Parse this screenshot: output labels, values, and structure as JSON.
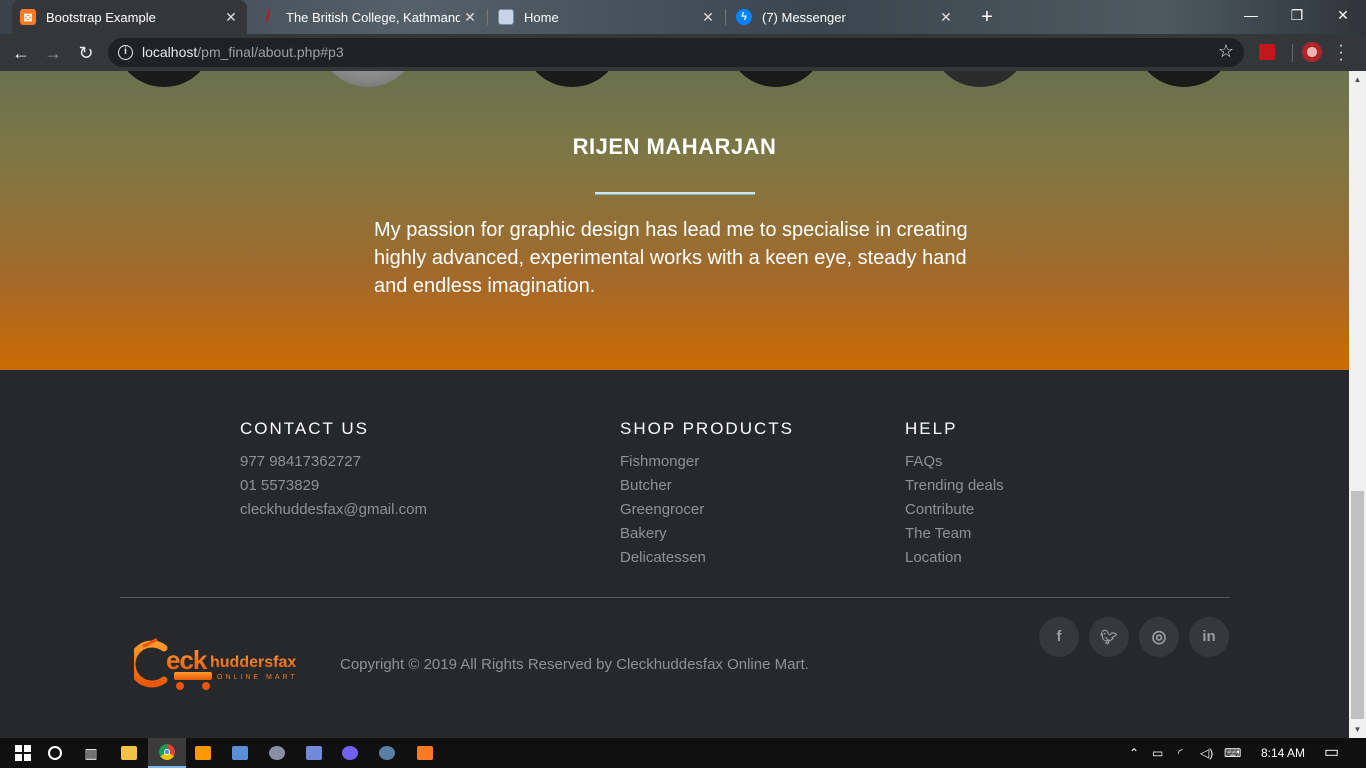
{
  "browser": {
    "tabs": [
      {
        "title": "Bootstrap Example",
        "icon": "xampp-icon",
        "color": "#fb7a24",
        "active": true
      },
      {
        "title": "The British College, Kathmandu :",
        "icon": "college-icon",
        "color": "#c2171c",
        "active": false
      },
      {
        "title": "Home",
        "icon": "page-icon",
        "color": "#c8d4e6",
        "active": false
      },
      {
        "title": "(7) Messenger",
        "icon": "messenger-icon",
        "color": "#0084ff",
        "active": false
      }
    ],
    "url_host": "localhost",
    "url_path": "/pm_final/about.php#p3"
  },
  "team": {
    "member_name": "RIJEN MAHARJAN",
    "member_bio": "My passion for graphic design has lead me to specialise in creating highly advanced, experimental works with a keen eye, steady hand and endless imagination."
  },
  "footer": {
    "contact": {
      "heading": "CONTACT US",
      "items": [
        "977 98417362727",
        "01 5573829",
        "cleckhuddesfax@gmail.com"
      ]
    },
    "shop": {
      "heading": "SHOP PRODUCTS",
      "items": [
        "Fishmonger",
        "Butcher",
        "Greengrocer",
        "Bakery",
        "Delicatessen"
      ]
    },
    "help": {
      "heading": "HELP",
      "items": [
        "FAQs",
        "Trending deals",
        "Contribute",
        "The Team",
        "Location"
      ]
    },
    "logo": {
      "name": "Cleckhuddersfax",
      "tagline": "ONLINE MART"
    },
    "copyright": "Copyright © 2019 All Rights Reserved by Cleckhuddesfax Online Mart.",
    "social": [
      {
        "name": "facebook-icon",
        "glyph": "f"
      },
      {
        "name": "twitter-icon",
        "glyph": "t"
      },
      {
        "name": "instagram-icon",
        "glyph": "◎"
      },
      {
        "name": "linkedin-icon",
        "glyph": "in"
      }
    ]
  },
  "taskbar": {
    "time": "8:14 AM"
  }
}
